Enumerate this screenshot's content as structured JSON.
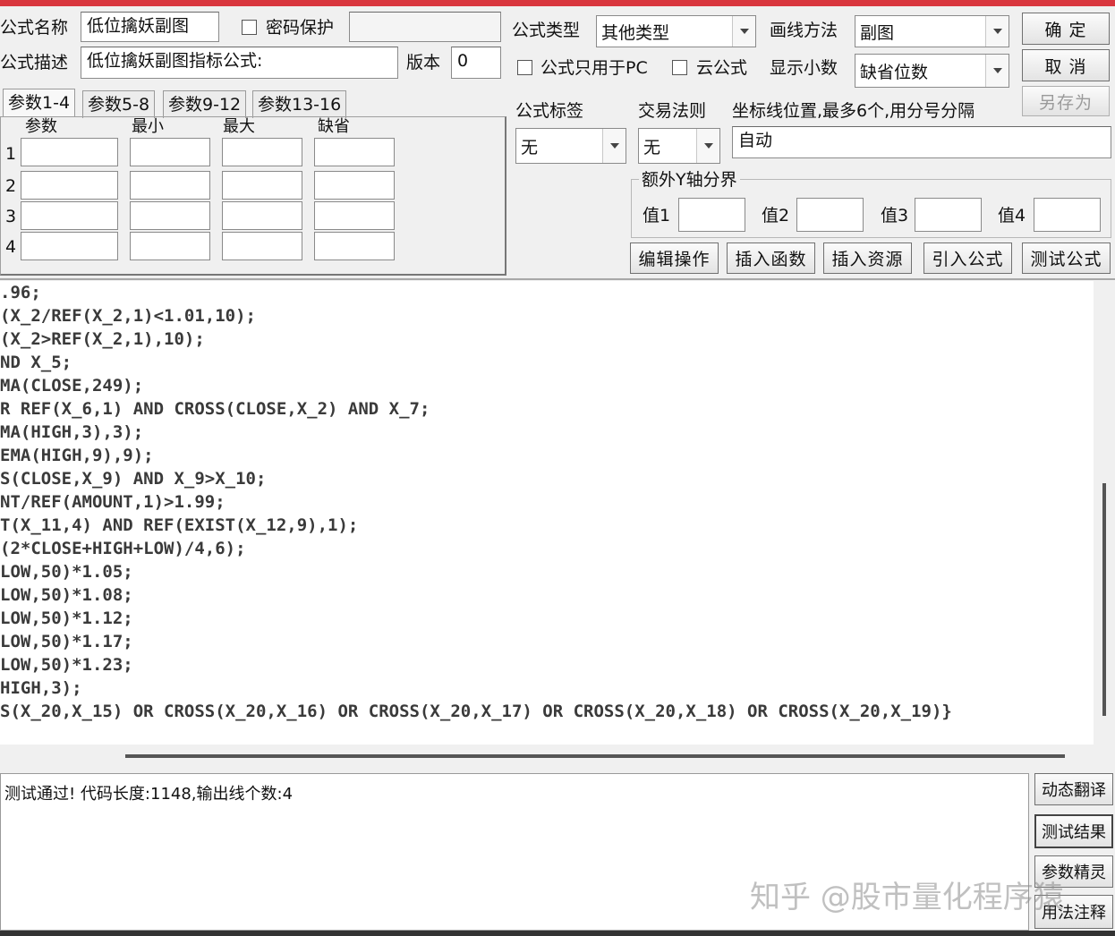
{
  "header": {
    "name_label": "公式名称",
    "name_value": "低位擒妖副图",
    "password_label": "密码保护",
    "desc_label": "公式描述",
    "desc_value": "低位擒妖副图指标公式:",
    "version_label": "版本",
    "version_value": "0"
  },
  "settings": {
    "type_label": "公式类型",
    "type_value": "其他类型",
    "draw_label": "画线方法",
    "draw_value": "副图",
    "pc_only_label": "公式只用于PC",
    "cloud_label": "云公式",
    "decimals_label": "显示小数",
    "decimals_value": "缺省位数",
    "tag_label": "公式标签",
    "tag_value": "无",
    "trade_label": "交易法则",
    "trade_value": "无",
    "axis_label": "坐标线位置,最多6个,用分号分隔",
    "axis_value": "自动",
    "ybound_label": "额外Y轴分界",
    "ybound_values": [
      "值1",
      "值2",
      "值3",
      "值4"
    ]
  },
  "buttons": {
    "ok": "确  定",
    "cancel": "取  消",
    "save_as": "另存为",
    "edit": "编辑操作",
    "insert_func": "插入函数",
    "insert_res": "插入资源",
    "import": "引入公式",
    "test": "测试公式",
    "dyn_translate": "动态翻译",
    "test_result": "测试结果",
    "param_wizard": "参数精灵",
    "usage_note": "用法注释"
  },
  "tabs": [
    "参数1-4",
    "参数5-8",
    "参数9-12",
    "参数13-16"
  ],
  "params": {
    "headers": [
      "参数",
      "最小",
      "最大",
      "缺省"
    ],
    "rows": [
      "1",
      "2",
      "3",
      "4"
    ]
  },
  "code_lines": [
    ".96;",
    "(X_2/REF(X_2,1)<1.01,10);",
    "(X_2>REF(X_2,1),10);",
    "ND X_5;",
    "MA(CLOSE,249);",
    "R REF(X_6,1) AND CROSS(CLOSE,X_2) AND X_7;",
    "MA(HIGH,3),3);",
    "EMA(HIGH,9),9);",
    "S(CLOSE,X_9) AND X_9>X_10;",
    "NT/REF(AMOUNT,1)>1.99;",
    "T(X_11,4) AND REF(EXIST(X_12,9),1);",
    "(2*CLOSE+HIGH+LOW)/4,6);",
    "LOW,50)*1.05;",
    "LOW,50)*1.08;",
    "LOW,50)*1.12;",
    "LOW,50)*1.17;",
    "LOW,50)*1.23;",
    "HIGH,3);",
    "S(X_20,X_15) OR CROSS(X_20,X_16) OR CROSS(X_20,X_17) OR CROSS(X_20,X_18) OR CROSS(X_20,X_19)}"
  ],
  "output_text": "测试通过! 代码长度:1148,输出线个数:4",
  "watermark": "知乎 @股市量化程序猿",
  "colors": {
    "accent_bar": "#d9363e"
  }
}
